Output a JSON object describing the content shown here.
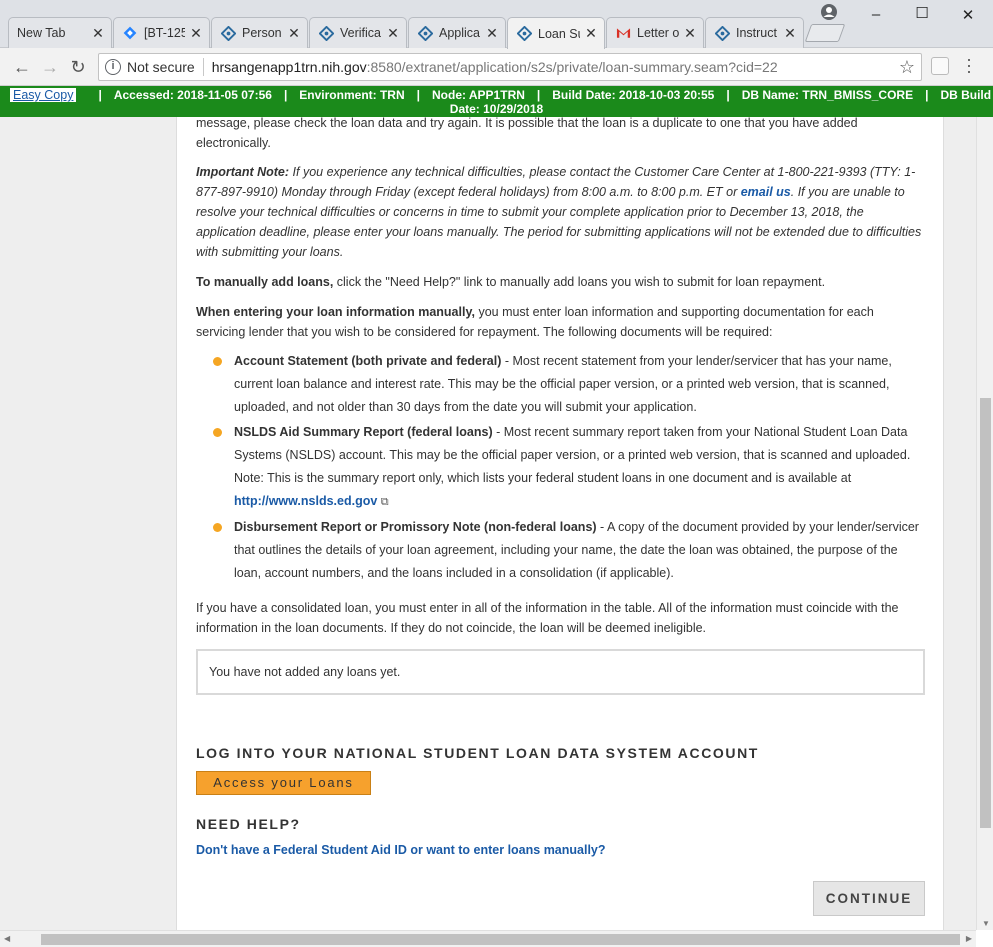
{
  "browser": {
    "tabs": [
      {
        "label": "New Tab",
        "icon": "none"
      },
      {
        "label": "[BT-125",
        "icon": "jira-diamond-icon"
      },
      {
        "label": "Person",
        "icon": "hrsa-logo-icon"
      },
      {
        "label": "Verifica",
        "icon": "hrsa-logo-icon"
      },
      {
        "label": "Applica",
        "icon": "hrsa-logo-icon"
      },
      {
        "label": "Loan Su",
        "icon": "hrsa-logo-icon"
      },
      {
        "label": "Letter o",
        "icon": "gmail-icon"
      },
      {
        "label": "Instruct",
        "icon": "hrsa-logo-icon"
      }
    ],
    "address": {
      "security_label": "Not secure",
      "host": "hrsangenapp1trn.nih.gov",
      "path": ":8580/extranet/application/s2s/private/loan-summary.seam?cid=22"
    }
  },
  "devbar": {
    "easy_copy": "Easy Copy",
    "accessed": "Accessed: 2018-11-05 07:56",
    "environment": "Environment: TRN",
    "node": "Node: APP1TRN",
    "build_date": "Build Date: 2018-10-03 20:55",
    "db_name": "DB Name: TRN_BMISS_CORE",
    "db_build": "DB Build",
    "date": "Date: 10/29/2018"
  },
  "content": {
    "partial_line_1": "message, please check the loan data and try again. It is possible that the loan is a duplicate to one that you have added",
    "partial_line_2": "electronically.",
    "important_label": "Important Note:",
    "important_text_1": " If you experience any technical difficulties, please contact the Customer Care Center at 1-800-221-9393 (TTY: 1-877-897-9910) Monday through Friday (except federal holidays) from 8:00 a.m. to 8:00 p.m. ET or ",
    "email_link": "email us",
    "important_text_2": ". If you are unable to resolve your technical difficulties or concerns in time to submit your complete application prior to December 13, 2018, the application deadline, please enter your loans manually. The period for submitting applications will not be extended due to difficulties with submitting your loans.",
    "manual_label": "To manually add loans,",
    "manual_text": " click the \"Need Help?\" link to manually add loans you wish to submit for loan repayment.",
    "entering_label": "When entering your loan information manually,",
    "entering_text": " you must enter loan information and supporting documentation for each servicing lender that you wish to be considered for repayment. The following documents will be required:",
    "bullets": [
      {
        "title": "Account Statement (both private and federal)",
        "text": " - Most recent statement from your lender/servicer that has your name, current loan balance and interest rate. This may be the official paper version, or a printed web version, that is scanned, uploaded, and not older than 30 days from the date you will submit your application."
      },
      {
        "title": "NSLDS Aid Summary Report (federal loans)",
        "text": " - Most recent summary report taken from your National Student Loan Data Systems (NSLDS) account. This may be the official paper version, or a printed web version, that is scanned and uploaded. Note: This is the summary report only, which lists your federal student loans in one document and is available at ",
        "link": "http://www.nslds.ed.gov"
      },
      {
        "title": "Disbursement Report or Promissory Note (non-federal loans)",
        "text": " - A copy of the document provided by your lender/servicer that outlines the details of your loan agreement, including your name, the date the loan was obtained, the purpose of the loan, account numbers, and the loans included in a consolidation (if applicable)."
      }
    ],
    "consolidated_text": "If you have a consolidated loan, you must enter in all of the information in the table. All of the information must coincide with the information in the loan documents. If they do not coincide, the loan will be deemed ineligible.",
    "no_loans": "You have not added any loans yet.",
    "nslds_heading": "LOG INTO YOUR NATIONAL STUDENT LOAN DATA SYSTEM ACCOUNT",
    "access_button": "Access your Loans",
    "need_help_heading": "NEED HELP?",
    "need_help_link": "Don't have a Federal Student Aid ID or want to enter loans manually?",
    "continue_button": "CONTINUE"
  }
}
